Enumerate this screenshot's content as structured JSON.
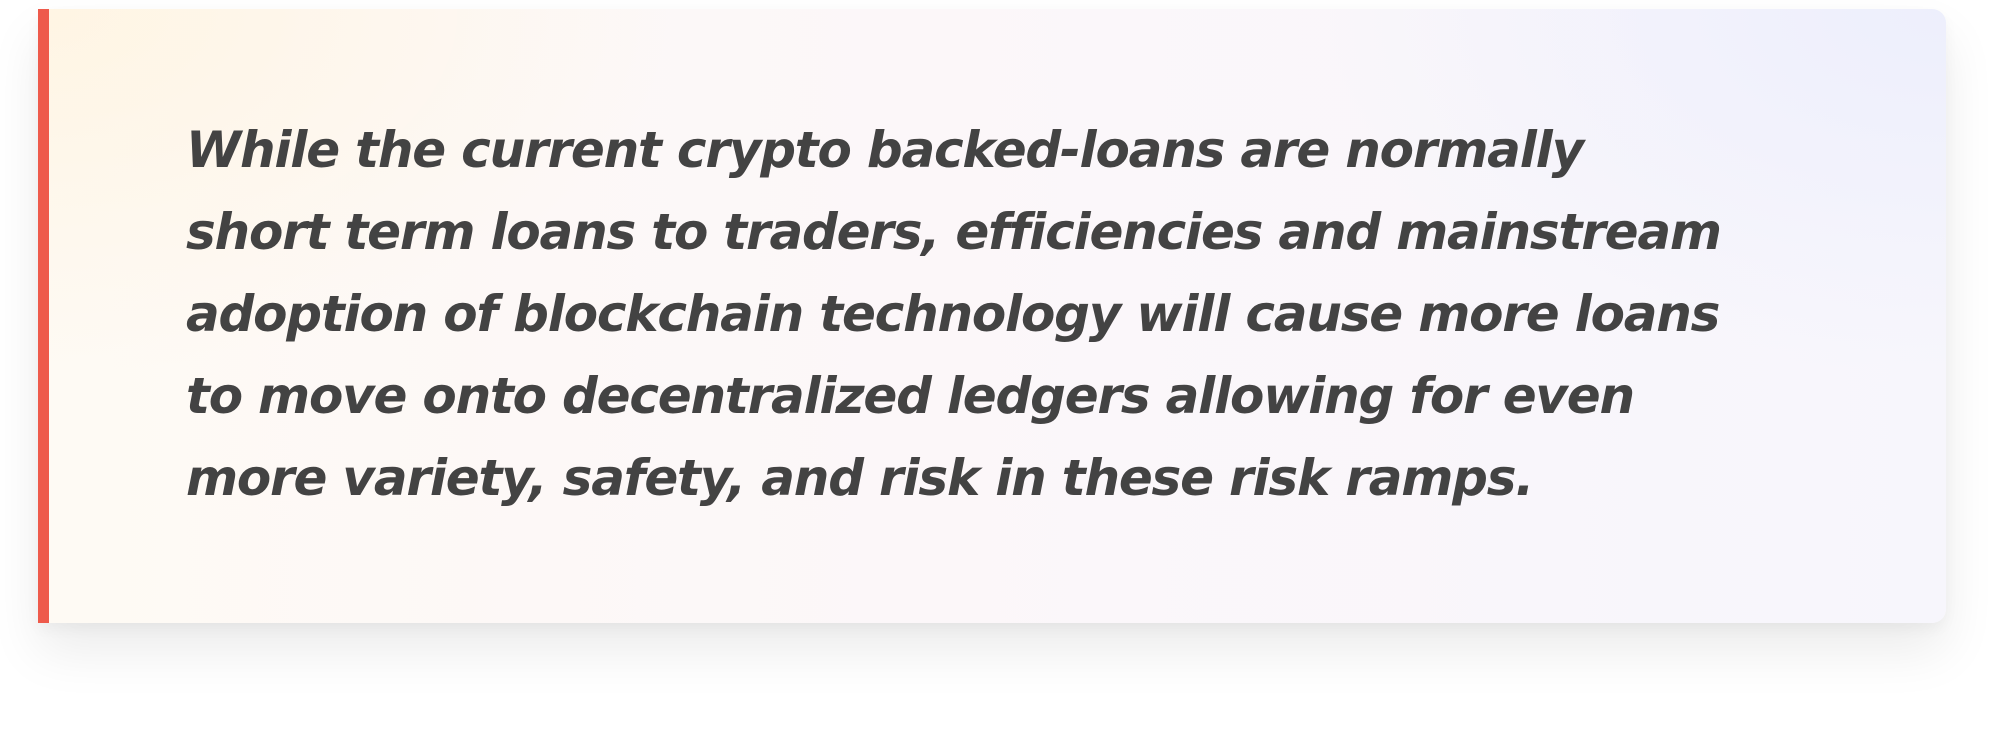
{
  "quote": {
    "lines": [
      "While the current crypto backed-loans are normally",
      "short term loans to traders, efficiencies and mainstream",
      "adoption of blockchain technology will cause more loans",
      "to move onto decentralized ledgers allowing for even",
      "more variety, safety, and risk in these risk ramps."
    ]
  },
  "colors": {
    "accent": "#ee5a4b",
    "text": "#434343"
  }
}
